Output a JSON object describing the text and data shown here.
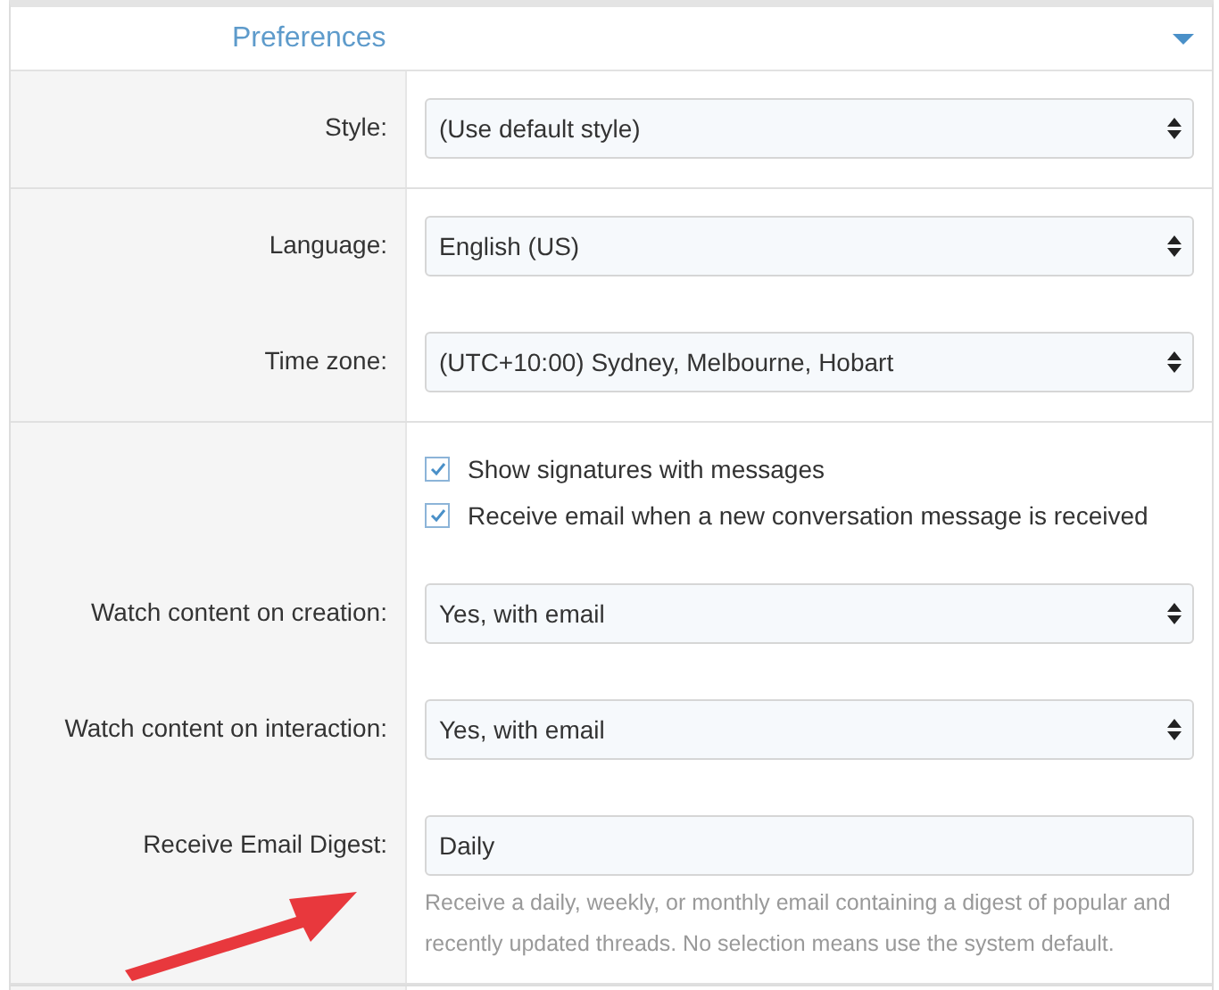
{
  "section": {
    "title": "Preferences",
    "expanded": true
  },
  "groups": [
    {
      "rows": [
        {
          "kind": "select",
          "label": "Style:",
          "value": "(Use default style)"
        }
      ]
    },
    {
      "rows": [
        {
          "kind": "select",
          "label": "Language:",
          "value": "English (US)"
        },
        {
          "kind": "select",
          "label": "Time zone:",
          "value": "(UTC+10:00) Sydney, Melbourne, Hobart"
        }
      ]
    },
    {
      "rows": [
        {
          "kind": "checks",
          "items": [
            {
              "label": "Show signatures with messages",
              "checked": true
            },
            {
              "label": "Receive email when a new conversation message is received",
              "checked": true
            }
          ]
        },
        {
          "kind": "select",
          "label": "Watch content on creation:",
          "value": "Yes, with email"
        },
        {
          "kind": "select",
          "label": "Watch content on interaction:",
          "value": "Yes, with email"
        },
        {
          "kind": "input",
          "label": "Receive Email Digest:",
          "value": "Daily",
          "hint": "Receive a daily, weekly, or monthly email containing a digest of popular and recently updated threads. No selection means use the system default."
        }
      ]
    }
  ],
  "annotation_arrow": true
}
